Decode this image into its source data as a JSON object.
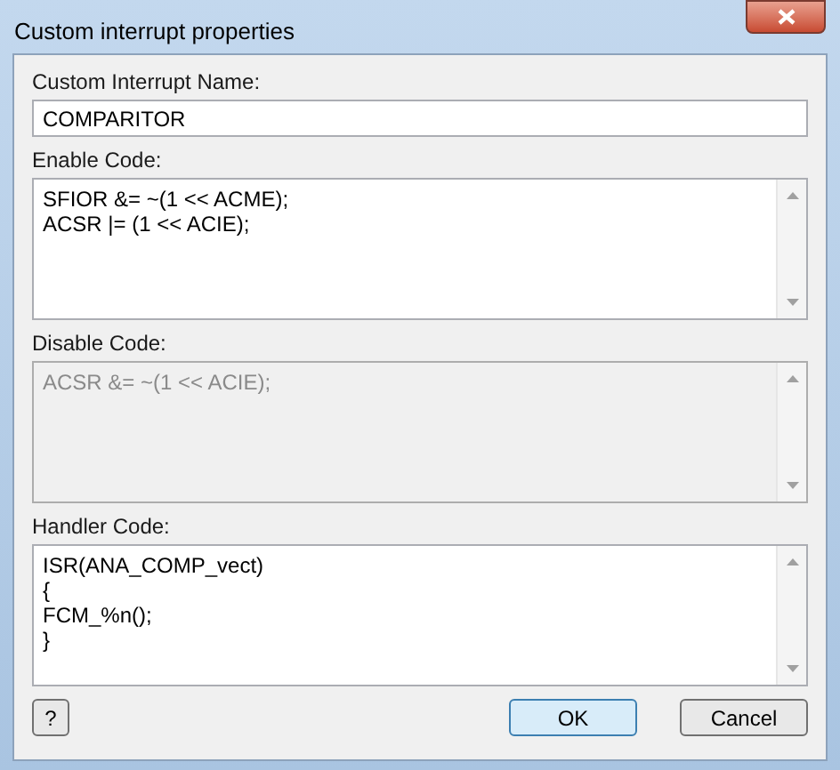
{
  "window": {
    "title": "Custom interrupt properties"
  },
  "name_field": {
    "label": "Custom Interrupt Name:",
    "value": "COMPARITOR"
  },
  "code_fields": [
    {
      "label": "Enable Code:",
      "disabled": false,
      "lines": [
        "SFIOR &= ~(1 << ACME);",
        "ACSR |= (1 << ACIE);"
      ]
    },
    {
      "label": "Disable Code:",
      "disabled": true,
      "lines": [
        "ACSR &= ~(1 << ACIE);"
      ]
    },
    {
      "label": "Handler Code:",
      "disabled": false,
      "lines": [
        "ISR(ANA_COMP_vect)",
        "{",
        "FCM_%n();",
        "}"
      ]
    }
  ],
  "buttons": [
    {
      "label": "?",
      "kind": "help",
      "default": false
    },
    {
      "label": "OK",
      "kind": "action",
      "default": true
    },
    {
      "label": "Cancel",
      "kind": "action",
      "default": false
    }
  ]
}
